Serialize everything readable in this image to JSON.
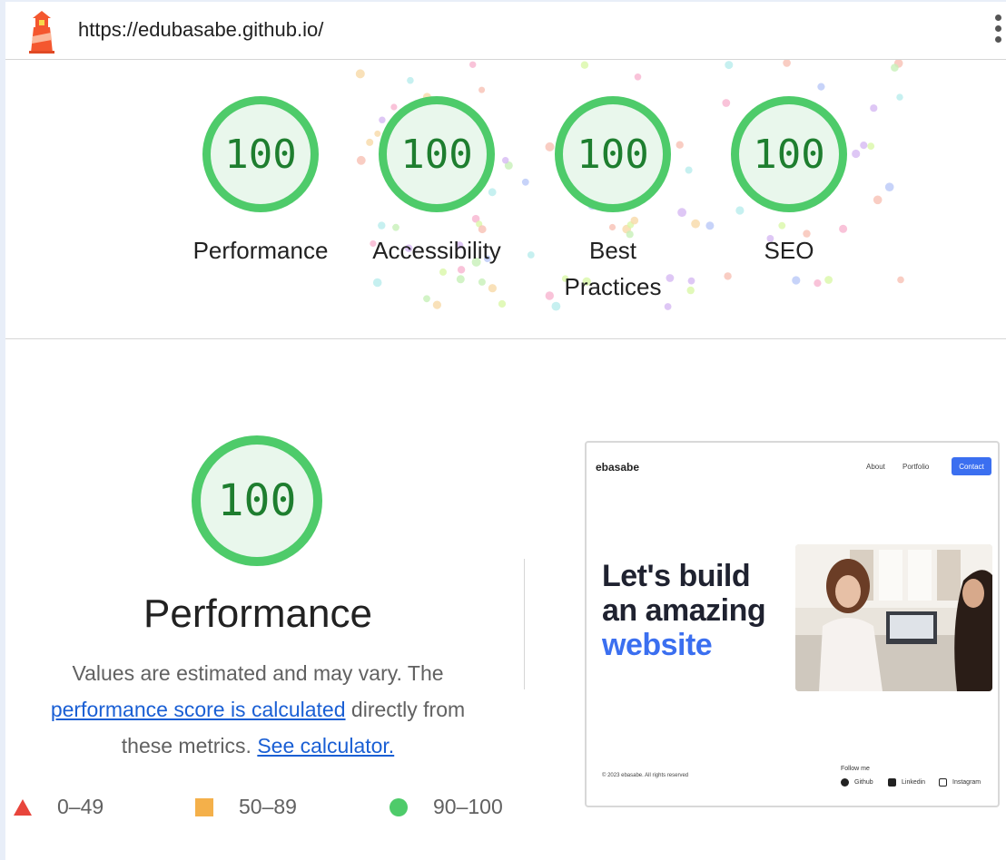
{
  "header": {
    "url": "https://edubasabe.github.io/",
    "logo_icon": "lighthouse-icon",
    "menu_icon": "kebab-menu-icon"
  },
  "summary": {
    "gauges": [
      {
        "score": "100",
        "label": "Performance"
      },
      {
        "score": "100",
        "label": "Accessibility"
      },
      {
        "score": "100",
        "label": "Best Practices"
      },
      {
        "score": "100",
        "label": "SEO"
      }
    ]
  },
  "performance": {
    "score": "100",
    "title": "Performance",
    "desc_part1": "Values are estimated and may vary. The ",
    "desc_link1": "performance score is calculated",
    "desc_part2": " directly from these metrics. ",
    "desc_link2": "See calculator."
  },
  "legend": [
    {
      "shape": "triangle",
      "range": "0–49",
      "color": "#e8453c"
    },
    {
      "shape": "square",
      "range": "50–89",
      "color": "#f4b04a"
    },
    {
      "shape": "circle",
      "range": "90–100",
      "color": "#4ecb6a"
    }
  ],
  "thumbnail": {
    "brand": "ebasabe",
    "nav_about": "About",
    "nav_portfolio": "Portfolio",
    "nav_contact": "Contact",
    "hero_line1": "Let's build",
    "hero_line2": "an amazing",
    "hero_line3": "website",
    "copyright": "© 2023 ebasabe. All rights reserved",
    "follow_title": "Follow me",
    "social_github": "Github",
    "social_linkedin": "Linkedin",
    "social_instagram": "Instagram"
  },
  "colors": {
    "pass_green": "#4ecb6a",
    "pass_text": "#1e7e2f",
    "link_blue": "#1a5fd4",
    "accent_blue": "#3b6ff0"
  }
}
